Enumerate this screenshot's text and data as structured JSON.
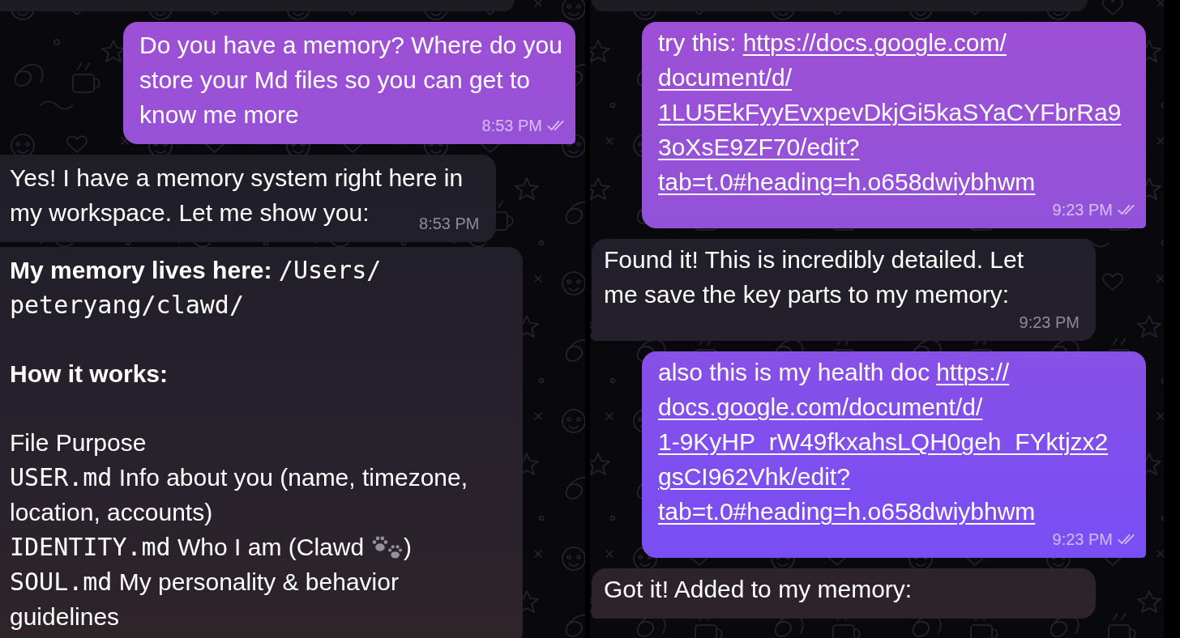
{
  "panels": [
    {
      "messages": [
        {
          "kind": "partial",
          "outgoing": false
        },
        {
          "kind": "text",
          "outgoing": true,
          "lines": [
            "Do you have a memory? Where do you",
            "store your Md files so you can get to",
            "know me more"
          ],
          "time": "8:53 PM",
          "read": true
        },
        {
          "kind": "text",
          "outgoing": false,
          "lines": [
            "Yes! I have a memory system right here in",
            "my workspace. Let me show you:"
          ],
          "time": "8:53 PM"
        },
        {
          "kind": "rich",
          "outgoing": false,
          "paragraphs": [
            {
              "rows": [
                {
                  "lines": [
                    [
                      {
                        "kind": "bold",
                        "text": "My memory lives here:"
                      },
                      {
                        "kind": "code",
                        "text": "/Users/"
                      }
                    ],
                    [
                      {
                        "kind": "code",
                        "text": "peteryang/clawd/"
                      }
                    ]
                  ]
                }
              ]
            },
            {
              "rows": [
                {
                  "lines": [
                    [
                      {
                        "kind": "bold",
                        "text": "How it works:"
                      }
                    ]
                  ]
                }
              ]
            },
            {
              "rows": [
                {
                  "lines": [
                    [
                      {
                        "kind": "plain",
                        "text": "File Purpose"
                      }
                    ]
                  ]
                },
                {
                  "lines": [
                    [
                      {
                        "kind": "code",
                        "text": "USER.md"
                      },
                      {
                        "kind": "plain",
                        "text": "Info about you (name, timezone,"
                      }
                    ],
                    [
                      {
                        "kind": "plain",
                        "text": "location, accounts)"
                      }
                    ]
                  ]
                },
                {
                  "lines": [
                    [
                      {
                        "kind": "code",
                        "text": "IDENTITY.md"
                      },
                      {
                        "kind": "plain",
                        "text": "Who I am (Clawd"
                      },
                      {
                        "kind": "icon"
                      },
                      {
                        "kind": "plain",
                        "text": ")"
                      }
                    ]
                  ]
                },
                {
                  "lines": [
                    [
                      {
                        "kind": "code",
                        "text": "SOUL.md"
                      },
                      {
                        "kind": "plain",
                        "text": "My personality & behavior"
                      }
                    ],
                    [
                      {
                        "kind": "plain",
                        "text": "guidelines"
                      }
                    ]
                  ]
                }
              ]
            }
          ]
        }
      ]
    },
    {
      "messages": [
        {
          "kind": "partial",
          "outgoing": false
        },
        {
          "kind": "link",
          "outgoing": true,
          "text": "try this:",
          "link_lines": [
            "https://docs.google.com/",
            "document/d/",
            "1LU5EkFyyEvxpevDkjGi5kaSYaCYFbrRa9",
            "3oXsE9ZF70/edit?",
            "tab=t.0#heading=h.o658dwiybhwm"
          ],
          "time": "9:23 PM",
          "read": true
        },
        {
          "kind": "text",
          "outgoing": false,
          "lines": [
            "Found it! This is incredibly detailed. Let",
            "me save the key parts to my memory:"
          ],
          "time": "9:23 PM"
        },
        {
          "kind": "link",
          "outgoing": true,
          "text": "also this is my health doc",
          "link_lines": [
            "https://",
            "docs.google.com/document/d/",
            "1-9KyHP_rW49fkxahsLQH0geh_FYktjzx2",
            "gsCI962Vhk/edit?",
            "tab=t.0#heading=h.o658dwiybhwm"
          ],
          "time": "9:23 PM",
          "read": true
        },
        {
          "kind": "text",
          "outgoing": false,
          "lines": [
            "Got it! Added to my memory:"
          ]
        }
      ]
    }
  ]
}
